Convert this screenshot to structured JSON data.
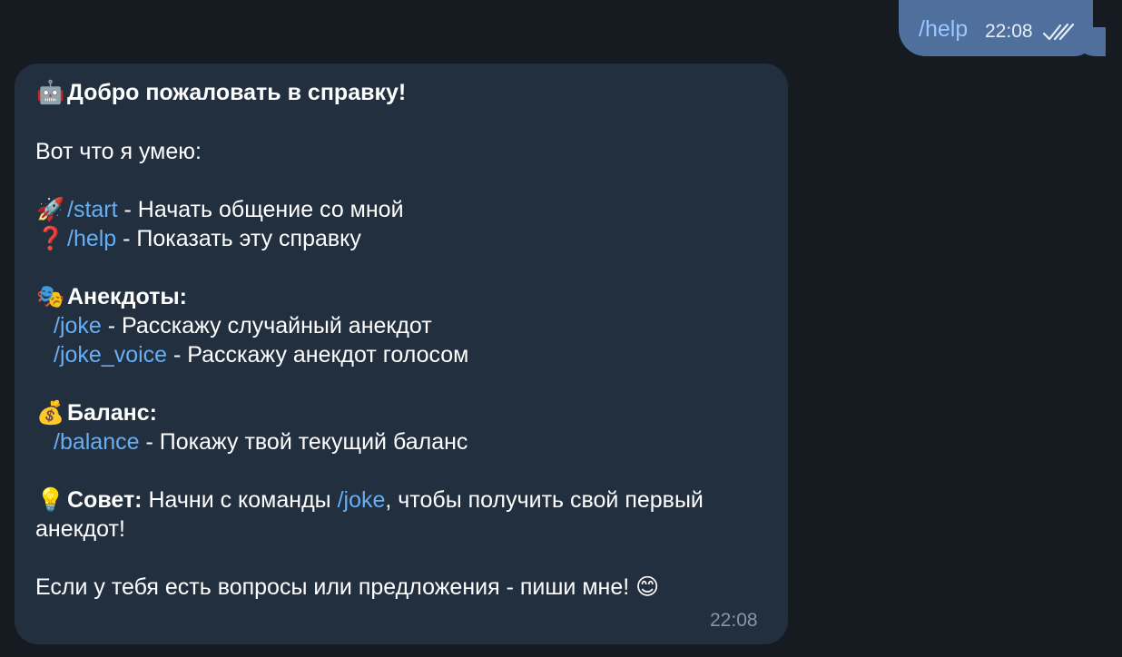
{
  "outgoing": {
    "text": "/help",
    "time": "22:08",
    "status": "read"
  },
  "incoming": {
    "title_emoji": "🤖",
    "title": "Добро пожаловать в справку!",
    "intro": "Вот что я умею:",
    "commands": [
      {
        "emoji": "🚀",
        "command": "/start",
        "desc": " - Начать общение со мной"
      },
      {
        "emoji": "❓",
        "command": "/help",
        "desc": " - Показать эту справку"
      }
    ],
    "jokes_section": {
      "emoji": "🎭",
      "heading": "Анекдоты:",
      "items": [
        {
          "command": "/joke",
          "desc": " - Расскажу случайный анекдот"
        },
        {
          "command": "/joke_voice",
          "desc": " - Расскажу анекдот голосом"
        }
      ]
    },
    "balance_section": {
      "emoji": "💰",
      "heading": "Баланс:",
      "items": [
        {
          "command": "/balance",
          "desc": " - Покажу твой текущий баланс"
        }
      ]
    },
    "tip": {
      "emoji": "💡",
      "label": "Совет:",
      "text_before": " Начни с команды ",
      "command": "/joke",
      "text_after": ", чтобы получить свой первый",
      "text_line2": "анекдот!"
    },
    "outro": "Если у тебя есть вопросы или предложения - пиши мне! ",
    "outro_emoji": "😊",
    "time": "22:08"
  },
  "colors": {
    "background": "#161b21",
    "incoming_bubble": "#222f3f",
    "outgoing_bubble": "#4f6f9c",
    "link": "#67aef2"
  }
}
